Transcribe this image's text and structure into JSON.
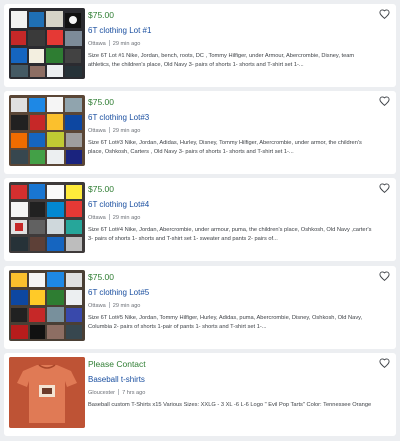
{
  "listings": [
    {
      "price": "$75.00",
      "title": "6T clothing Lot #1",
      "location": "Ottawa",
      "time": "29 min ago",
      "description": "Size 6T Lot #1 Nike, Jordan, bench, roots, DC , Tommy Hilfiger, under Armour, Abercrombie, Disney, team athletics, the children's place, Old Navy 3- pairs of shorts 1- shorts and T-shirt set 1-...",
      "image_icon": "clothing-photo-icon"
    },
    {
      "price": "$75.00",
      "title": "6T clothing Lot#3",
      "location": "Ottawa",
      "time": "29 min ago",
      "description": "Size 6T Lot#3 Nike, Jordan, Adidas, Hurley, Disney, Tommy Hilfiger, Abercrombie, under armor, the children's place, Oshkosh, Carters , Old Navy 3- pairs of shorts 1- shorts and T-shirt set 1-...",
      "image_icon": "clothing-photo-icon"
    },
    {
      "price": "$75.00",
      "title": "6T clothing Lot#4",
      "location": "Ottawa",
      "time": "29 min ago",
      "description": "Size 6T Lot#4 Nike, Jordan, Abercrombie, under armour, puma, the children's place, Oshkosh, Old Navy ,carter's 3- pairs of shorts 1- shorts and T-shirt set 1- sweater and pants 2- pairs of...",
      "image_icon": "clothing-photo-icon"
    },
    {
      "price": "$75.00",
      "title": "6T clothing Lot#5",
      "location": "Ottawa",
      "time": "29 min ago",
      "description": "Size 6T Lot#5 Nike, Jordan, Tommy Hilfiger, Hurley, Adidas, puma, Abercrombie, Disney, Oshkosh, Old Navy, Columbia 2- pairs of shorts 1-pair of pants 1- shorts and T-shirt set 1-...",
      "image_icon": "clothing-photo-icon"
    },
    {
      "price": "Please Contact",
      "title": "Baseball t-shirts",
      "location": "Gloucester",
      "time": "7 hrs ago",
      "description": "Baseball custom T-Shirts x15 Various Sizes: XXLG - 3 XL -6 L-6 Logo \" Evil Pop Tarts\" Color: Tennessee Orange",
      "image_icon": "tshirt-photo-icon"
    }
  ],
  "favorite_icon": "heart-outline-icon",
  "colors": {
    "price": "#2e7d32",
    "title": "#1a4fa0",
    "background": "#eceef1"
  }
}
